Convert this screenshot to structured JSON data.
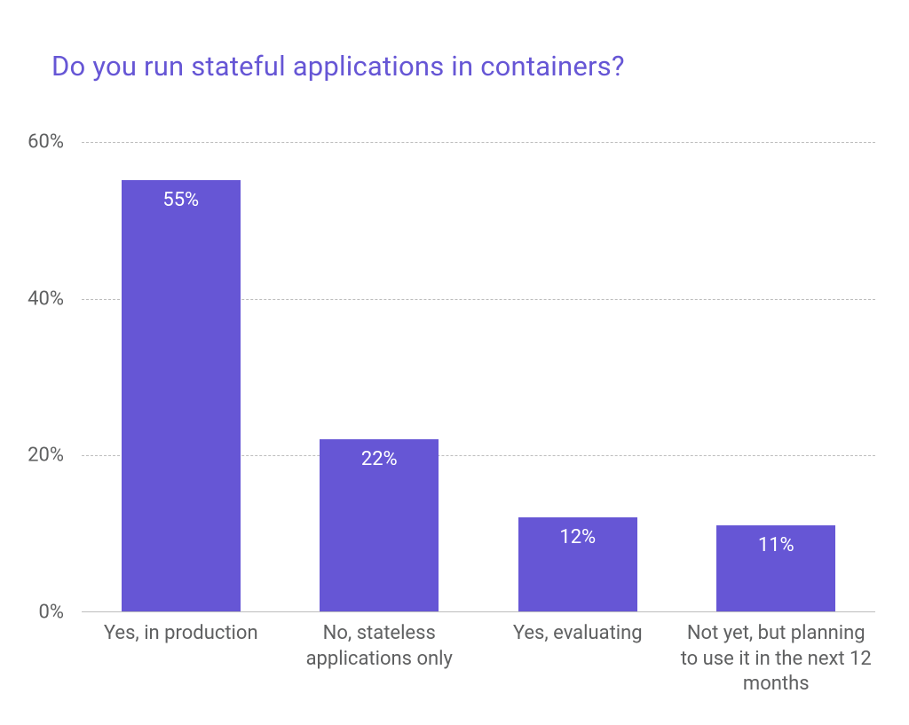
{
  "chart_data": {
    "type": "bar",
    "title": "Do you run stateful applications in containers?",
    "categories": [
      "Yes, in production",
      "No, stateless applications only",
      "Yes, evaluating",
      "Not yet, but planning to use it in the next 12 months"
    ],
    "values": [
      55,
      22,
      12,
      11
    ],
    "value_labels": [
      "55%",
      "22%",
      "12%",
      "11%"
    ],
    "ylim": [
      0,
      60
    ],
    "yticks": [
      0,
      20,
      40,
      60
    ],
    "ytick_labels": [
      "0%",
      "20%",
      "40%",
      "60%"
    ],
    "bar_color": "#6656d5",
    "title_color": "#6656d5",
    "xlabel": "",
    "ylabel": ""
  }
}
